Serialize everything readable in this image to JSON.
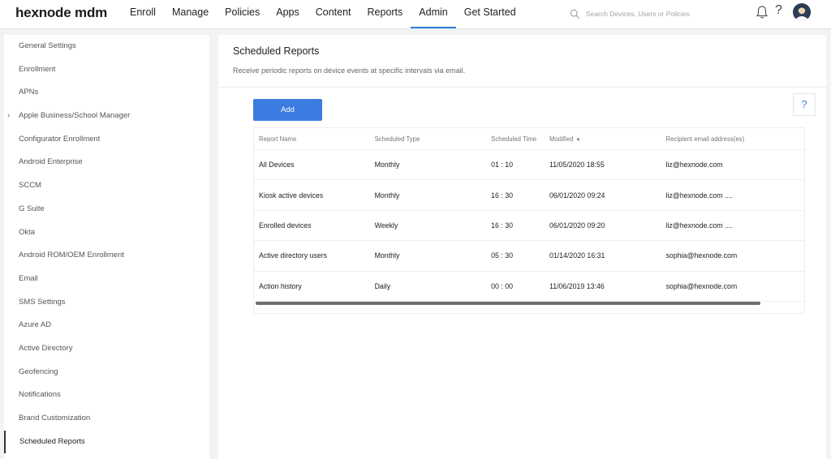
{
  "app": {
    "logo": "hexnode mdm"
  },
  "nav": {
    "items": [
      {
        "label": "Enroll"
      },
      {
        "label": "Manage"
      },
      {
        "label": "Policies"
      },
      {
        "label": "Apps"
      },
      {
        "label": "Content"
      },
      {
        "label": "Reports"
      },
      {
        "label": "Admin",
        "active": true
      },
      {
        "label": "Get Started"
      }
    ]
  },
  "search": {
    "placeholder": "Search Devices, Users or Policies"
  },
  "header_icons": {
    "help": "?",
    "accent": "#2f7de1"
  },
  "sidebar": {
    "items": [
      {
        "label": "General Settings"
      },
      {
        "label": "Enrollment"
      },
      {
        "label": "APNs"
      },
      {
        "label": "Apple Business/School Manager"
      },
      {
        "label": "Configurator Enrollment"
      },
      {
        "label": "Android Enterprise"
      },
      {
        "label": "SCCM"
      },
      {
        "label": "G Suite"
      },
      {
        "label": "Okta"
      },
      {
        "label": "Android ROM/OEM Enrollment"
      },
      {
        "label": "Email"
      },
      {
        "label": "SMS Settings"
      },
      {
        "label": "Azure AD"
      },
      {
        "label": "Active Directory"
      },
      {
        "label": "Geofencing"
      },
      {
        "label": "Notifications"
      },
      {
        "label": "Brand Customization"
      },
      {
        "label": "Scheduled Reports"
      }
    ],
    "chevron": "›"
  },
  "main": {
    "title": "Scheduled Reports",
    "subtitle": "Receive periodic reports on device events at specific intervals via email.",
    "add_label": "Add",
    "help_label": "?",
    "button_color": "#3a7ce0"
  },
  "table": {
    "headers": [
      "Report Name",
      "Scheduled Type",
      "Scheduled Time",
      "Modified",
      "Recipient email address(es)"
    ],
    "sort_arrow": "▼",
    "rows": [
      [
        "All Devices",
        "Monthly",
        "01 : 10",
        "11/05/2020 18:55",
        "liz@hexnode.com"
      ],
      [
        "Kiosk active devices",
        "Monthly",
        "16 : 30",
        "06/01/2020 09:24",
        "liz@hexnode.com ...."
      ],
      [
        "Enrolled devices",
        "Weekly",
        "16 : 30",
        "06/01/2020 09:20",
        "liz@hexnode.com ...."
      ],
      [
        "Active directory users",
        "Monthly",
        "05 : 30",
        "01/14/2020 16:31",
        "sophia@hexnode.com"
      ],
      [
        "Action history",
        "Daily",
        "00 : 00",
        "11/06/2019 13:46",
        "sophia@hexnode.com"
      ]
    ]
  }
}
